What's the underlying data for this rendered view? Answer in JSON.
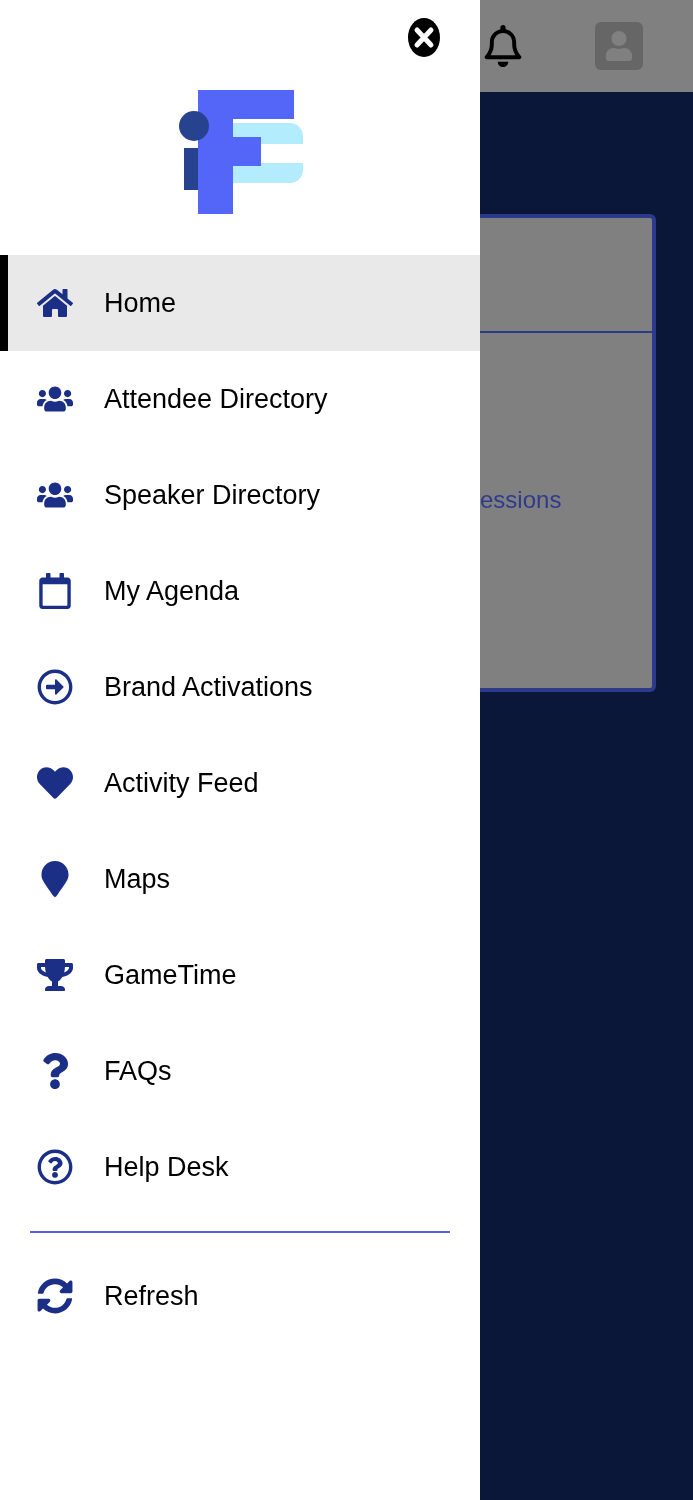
{
  "menu": {
    "items": [
      {
        "label": "Home",
        "selected": true
      },
      {
        "label": "Attendee Directory",
        "selected": false
      },
      {
        "label": "Speaker Directory",
        "selected": false
      },
      {
        "label": "My Agenda",
        "selected": false
      },
      {
        "label": "Brand Activations",
        "selected": false
      },
      {
        "label": "Activity Feed",
        "selected": false
      },
      {
        "label": "Maps",
        "selected": false
      },
      {
        "label": "GameTime",
        "selected": false
      },
      {
        "label": "FAQs",
        "selected": false
      },
      {
        "label": "Help Desk",
        "selected": false
      }
    ],
    "footer_items": [
      {
        "label": "Refresh",
        "selected": false
      }
    ]
  },
  "background": {
    "card_text": "essions"
  }
}
